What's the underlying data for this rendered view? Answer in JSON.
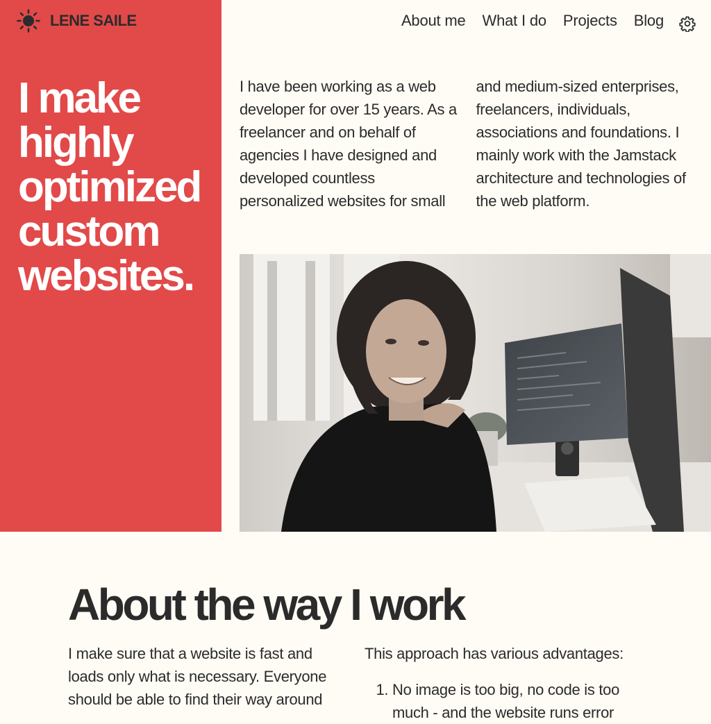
{
  "site": {
    "name": "LENE SAILE",
    "logo_icon": "sun-icon"
  },
  "nav": {
    "items": [
      {
        "label": "About me"
      },
      {
        "label": "What I do"
      },
      {
        "label": "Projects"
      },
      {
        "label": "Blog"
      }
    ],
    "settings_icon": "gear-icon"
  },
  "hero": {
    "title": "I make highly optimized custom websites.",
    "intro": "I have been working as a web developer for over 15 years. As a freelancer and on behalf of agencies I have designed and developed countless personalized websites for small and medium-sized enterprises, freelancers, individuals, associations and foundations. I mainly work with the Jamstack architecture and technologies of the web platform."
  },
  "about": {
    "title": "About the way I work",
    "left_text": "I make sure that a website is fast and loads only what is necessary. Everyone should be able to find their way around",
    "right_intro": "This approach has various advantages:",
    "advantages": [
      "No image is too big, no code is too much - and the website runs error"
    ]
  },
  "colors": {
    "accent": "#e24949",
    "background": "#fffcf5",
    "text": "#2b2b2b"
  }
}
